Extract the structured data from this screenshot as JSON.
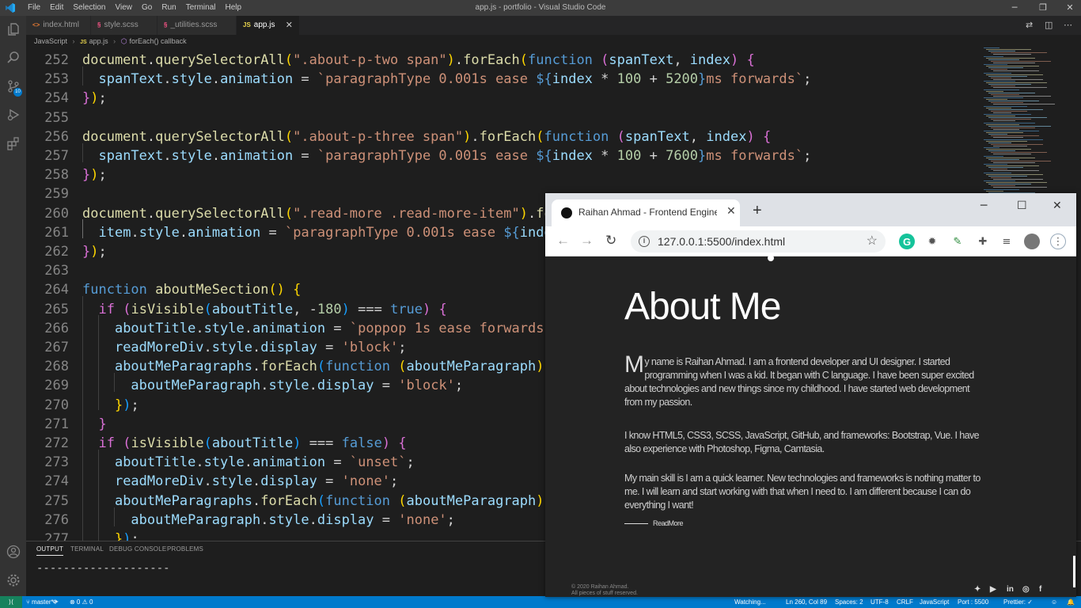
{
  "window": {
    "title": "app.js - portfolio - Visual Studio Code",
    "menu": [
      "File",
      "Edit",
      "Selection",
      "View",
      "Go",
      "Run",
      "Terminal",
      "Help"
    ]
  },
  "activity": {
    "scm_badge": "10"
  },
  "tabs": [
    {
      "label": "index.html",
      "icon": "<>",
      "icon_color": "#e37933"
    },
    {
      "label": "style.scss",
      "icon": "§",
      "icon_color": "#f55385"
    },
    {
      "label": "_utilities.scss",
      "icon": "§",
      "icon_color": "#f55385"
    },
    {
      "label": "app.js",
      "icon": "JS",
      "icon_color": "#e8d44d",
      "active": true
    }
  ],
  "breadcrumb": {
    "lang": "JavaScript",
    "file": "app.js",
    "symbol": "forEach() callback",
    "js_badge": "JS"
  },
  "editor": {
    "lines": [
      {
        "n": "252"
      },
      {
        "n": "253"
      },
      {
        "n": "254"
      },
      {
        "n": "255"
      },
      {
        "n": "256"
      },
      {
        "n": "257"
      },
      {
        "n": "258"
      },
      {
        "n": "259"
      },
      {
        "n": "260"
      },
      {
        "n": "261"
      },
      {
        "n": "262"
      },
      {
        "n": "263"
      },
      {
        "n": "264"
      },
      {
        "n": "265"
      },
      {
        "n": "266"
      },
      {
        "n": "267"
      },
      {
        "n": "268"
      },
      {
        "n": "269"
      },
      {
        "n": "270"
      },
      {
        "n": "271"
      },
      {
        "n": "272"
      },
      {
        "n": "273"
      },
      {
        "n": "274"
      },
      {
        "n": "275"
      },
      {
        "n": "276"
      },
      {
        "n": "277"
      }
    ]
  },
  "panel": {
    "tabs": [
      "OUTPUT",
      "TERMINAL",
      "DEBUG CONSOLE",
      "PROBLEMS"
    ],
    "output": "--------------------"
  },
  "status": {
    "branch": "master*+",
    "sync": "⟳",
    "errors": "⊗ 0 ⚠ 0",
    "watching": "Watching...",
    "position": "Ln 260, Col 89",
    "spaces": "Spaces: 2",
    "encoding": "UTF-8",
    "eol": "CRLF",
    "language": "JavaScript",
    "port": "Port : 5500",
    "prettier": "Prettier: ✓"
  },
  "browser": {
    "tab_title": "Raihan Ahmad - Frontend Engineer",
    "url": "127.0.0.1:5500/index.html",
    "page": {
      "heading": "About Me",
      "para1_dropcap": "M",
      "para1": "y name is Raihan Ahmad. I am a frontend developer and UI designer. I started programming when I was a kid. It began with C language. I have been super excited about technologies and new things since my childhood. I have started web development from my passion.",
      "para2": "I know HTML5, CSS3, SCSS, JavaScript, GitHub, and frameworks: Bootstrap, Vue. I have also experience with Photoshop, Figma, Camtasia.",
      "para3": "My main skill is I am a quick learner. New technologies and frameworks is nothing matter to me. I will learn and start working with that when I need to. I am different because I can do everything I want!",
      "read_more": "ReadMore",
      "footer_line1": "© 2020 Raihan Ahmad.",
      "footer_line2": "All pieces of stuff reserved.",
      "social": [
        "twitter-icon",
        "youtube-icon",
        "linkedin-icon",
        "instagram-icon",
        "facebook-icon"
      ]
    }
  }
}
